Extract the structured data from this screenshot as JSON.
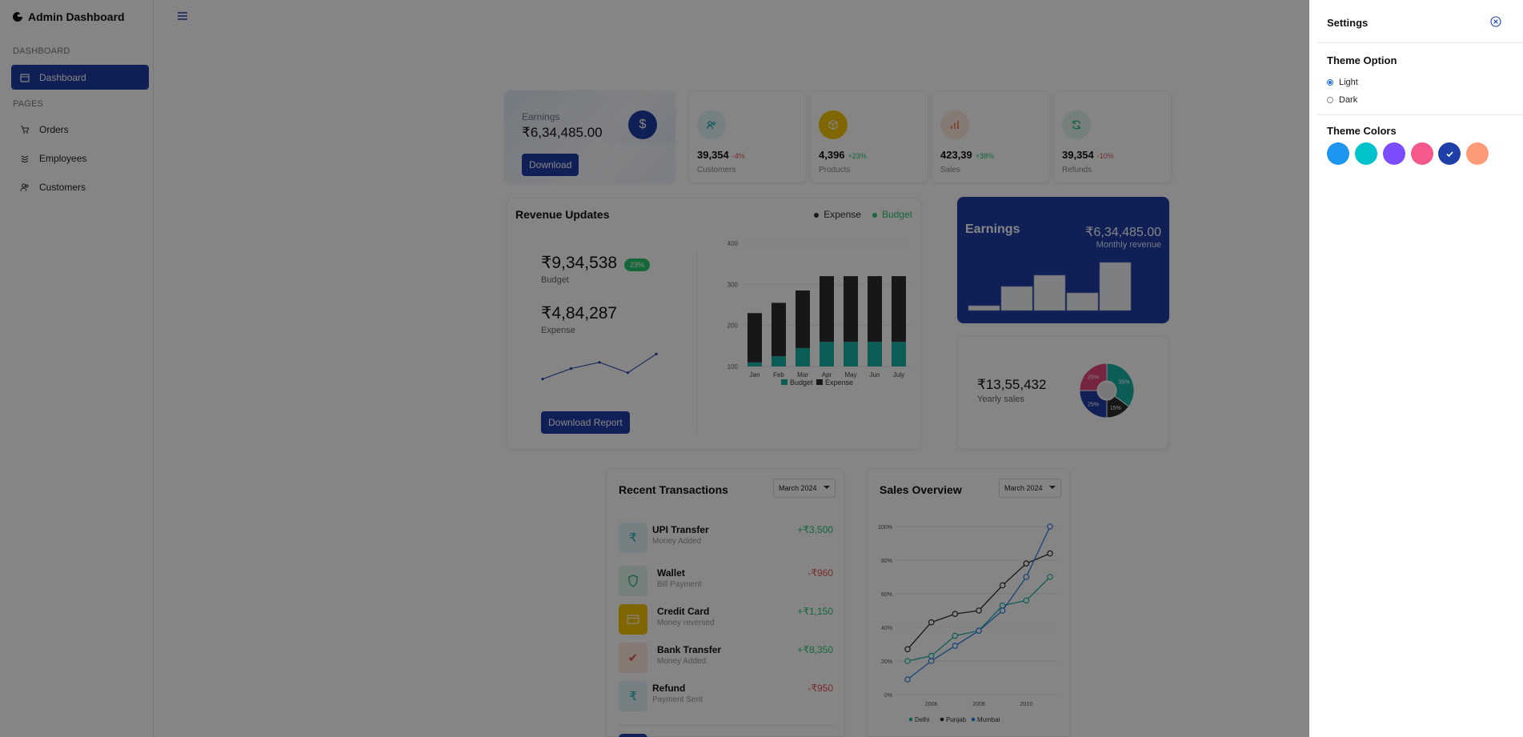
{
  "app": {
    "title": "Admin Dashboard"
  },
  "sidebar": {
    "section_dashboard": "DASHBOARD",
    "section_pages": "PAGES",
    "items": [
      {
        "label": "Dashboard",
        "icon": "calendar-icon",
        "active": true
      },
      {
        "label": "Orders",
        "icon": "cart-icon",
        "active": false
      },
      {
        "label": "Employees",
        "icon": "layers-icon",
        "active": false
      },
      {
        "label": "Customers",
        "icon": "users-icon",
        "active": false
      }
    ]
  },
  "earnings_card": {
    "label": "Earnings",
    "amount": "₹6,34,485.00",
    "button": "Download",
    "icon": "dollar-icon",
    "symbol": "$"
  },
  "stats": [
    {
      "value": "39,354",
      "change": "-4%",
      "change_color": "#ea5455",
      "label": "Customers",
      "icon": "users-icon",
      "icon_bg": "#e3f4f7",
      "icon_color": "#18a9b5"
    },
    {
      "value": "4,396",
      "change": "+23%",
      "change_color": "#28c76f",
      "label": "Products",
      "icon": "box-icon",
      "icon_bg": "#f5c400",
      "icon_color": "#ffffff"
    },
    {
      "value": "423,39",
      "change": "+38%",
      "change_color": "#28c76f",
      "label": "Sales",
      "icon": "bar-chart-icon",
      "icon_bg": "#fde8dc",
      "icon_color": "#ee7b52"
    },
    {
      "value": "39,354",
      "change": "-10%",
      "change_color": "#ea5455",
      "label": "Refunds",
      "icon": "refresh-icon",
      "icon_bg": "#e0f5ec",
      "icon_color": "#28b376"
    }
  ],
  "revenue": {
    "title": "Revenue Updates",
    "legend_expense": "Expense",
    "legend_budget": "Budget",
    "budget_amount": "₹9,34,538",
    "budget_badge": "23%",
    "budget_label": "Budget",
    "expense_amount": "₹4,84,287",
    "expense_label": "Expense",
    "button": "Download Report",
    "budget_color": "#1ab3a8",
    "expense_color": "#2d2d2d"
  },
  "earnings_big": {
    "title": "Earnings",
    "amount": "₹6,34,485.00",
    "subtitle": "Monthly revenue"
  },
  "yearly": {
    "amount": "₹13,55,432",
    "label": "Yearly sales"
  },
  "transactions": {
    "title": "Recent Transactions",
    "month": "March 2024",
    "items": [
      {
        "name": "UPI Transfer",
        "desc": "Money Added",
        "amount": "+₹3,500",
        "positive": true,
        "icon": "rupee-icon",
        "glyph": "₹",
        "bg": "#e3f4f7",
        "fg": "#18a9b5"
      },
      {
        "name": "Wallet",
        "desc": "Bill Payment",
        "amount": "-₹960",
        "positive": false,
        "icon": "shield-icon",
        "glyph": "",
        "bg": "#e0f5ec",
        "fg": "#28b376"
      },
      {
        "name": "Credit Card",
        "desc": "Money reversed",
        "amount": "+₹1,150",
        "positive": true,
        "icon": "credit-card-icon",
        "glyph": "",
        "bg": "#f5c400",
        "fg": "#ffffff"
      },
      {
        "name": "Bank Transfer",
        "desc": "Money Added",
        "amount": "+₹8,350",
        "positive": true,
        "icon": "check-icon",
        "glyph": "✔",
        "bg": "#fde8dc",
        "fg": "#ea5455"
      },
      {
        "name": "Refund",
        "desc": "Payment Sent",
        "amount": "-₹950",
        "positive": false,
        "icon": "rupee-icon",
        "glyph": "₹",
        "bg": "#e3f4f7",
        "fg": "#18a9b5"
      }
    ]
  },
  "sales_overview": {
    "title": "Sales Overview",
    "month": "March 2024"
  },
  "settings": {
    "title": "Settings",
    "theme_option_title": "Theme Option",
    "theme_options": [
      "Light",
      "Dark"
    ],
    "selected_theme": "Light",
    "theme_colors_title": "Theme Colors",
    "colors": [
      "#1e96f0",
      "#00c2cb",
      "#7b4dff",
      "#f5588a",
      "#1f3fa8",
      "#ff9a76"
    ],
    "selected_color": "#1f3fa8"
  },
  "chart_data": [
    {
      "type": "bar",
      "title": "",
      "categories": [
        "Jan",
        "Feb",
        "Mar",
        "Apr",
        "May",
        "Jun",
        "July"
      ],
      "series": [
        {
          "name": "Budget",
          "values": [
            110,
            125,
            145,
            160,
            160,
            160,
            160
          ]
        },
        {
          "name": "Expense",
          "values": [
            120,
            130,
            140,
            160,
            160,
            160,
            160
          ]
        }
      ],
      "stacked": true,
      "ylim": [
        100,
        400
      ],
      "yticks": [
        100,
        200,
        300,
        400
      ],
      "legend": "bottom"
    },
    {
      "type": "line",
      "title": "",
      "values": [
        20,
        45,
        60,
        35,
        80
      ]
    },
    {
      "type": "bar",
      "title": "",
      "values": [
        3,
        15,
        22,
        11,
        30
      ]
    },
    {
      "type": "pie",
      "title": "",
      "labels": [
        "35%",
        "15%",
        "25%",
        "25%"
      ],
      "values": [
        35,
        15,
        25,
        25
      ],
      "colors": [
        "#1ab3a8",
        "#2d2d2d",
        "#1f3fa8",
        "#e2467a"
      ]
    },
    {
      "type": "line",
      "title": "",
      "x": [
        2005,
        2006,
        2007,
        2008,
        2009,
        2010,
        2011
      ],
      "x_ticks": [
        "2006",
        "2008",
        "2010"
      ],
      "yticks": [
        "0%",
        "20%",
        "40%",
        "60%",
        "80%",
        "100%"
      ],
      "ylim": [
        0,
        100
      ],
      "series": [
        {
          "name": "Delhi",
          "color": "#1ab3a8",
          "values": [
            20,
            23,
            35,
            38,
            53,
            56,
            70
          ]
        },
        {
          "name": "Punjab",
          "color": "#2d2d2d",
          "values": [
            27,
            43,
            48,
            50,
            65,
            78,
            84
          ]
        },
        {
          "name": "Mumbai",
          "color": "#2b7de9",
          "values": [
            9,
            20,
            29,
            38,
            50,
            70,
            100
          ]
        }
      ],
      "legend": "bottom"
    }
  ]
}
